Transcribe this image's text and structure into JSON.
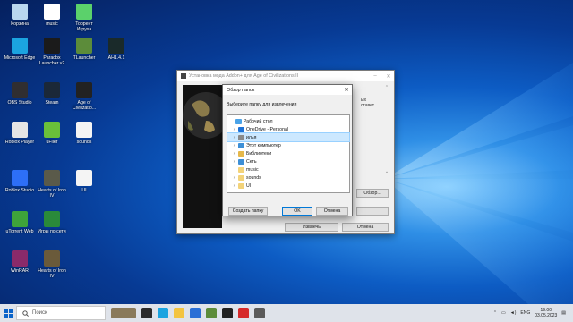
{
  "desktop": {
    "icons": [
      {
        "label": "Корзина",
        "icon": "recycle-bin-icon",
        "color": "#b9d7ef"
      },
      {
        "label": "music",
        "icon": "file-icon",
        "color": "#ffffff"
      },
      {
        "label": "Торрент Игруха",
        "icon": "torrent-app-icon",
        "color": "#5bd16b"
      },
      {
        "label": "Microsoft Edge",
        "icon": "edge-icon",
        "color": "#1ba4e0"
      },
      {
        "label": "Paradox Launcher v2",
        "icon": "paradox-icon",
        "color": "#1b1b1b"
      },
      {
        "label": "TLauncher",
        "icon": "minecraft-icon",
        "color": "#5c8c3a"
      },
      {
        "label": "AH1.4.1",
        "icon": "ah-icon",
        "color": "#1a2a2a"
      },
      {
        "label": "OBS Studio",
        "icon": "obs-icon",
        "color": "#302e31"
      },
      {
        "label": "Steam",
        "icon": "steam-icon",
        "color": "#1b2838"
      },
      {
        "label": "Age of Civilizatio...",
        "icon": "age-of-civilizations-icon",
        "color": "#222222"
      },
      {
        "label": "Roblox Player",
        "icon": "roblox-icon",
        "color": "#e5e5e5"
      },
      {
        "label": "uFiler",
        "icon": "ufiler-icon",
        "color": "#6abf3a"
      },
      {
        "label": "sounds",
        "icon": "file-icon",
        "color": "#f4f4f4"
      },
      {
        "label": "Roblox Studio",
        "icon": "roblox-studio-icon",
        "color": "#2d6ff7"
      },
      {
        "label": "Hearts of Iron IV",
        "icon": "hearts-of-iron-icon",
        "color": "#5a5a4a"
      },
      {
        "label": "UI",
        "icon": "file-icon",
        "color": "#f4f4f4"
      },
      {
        "label": "uTorrent Web",
        "icon": "utorrent-icon",
        "color": "#3ea43a"
      },
      {
        "label": "Игры по сети",
        "icon": "ftp-icon",
        "color": "#2a8a3a"
      },
      {
        "label": "WinRAR",
        "icon": "winrar-icon",
        "color": "#8a2a6a"
      },
      {
        "label": "Hearts of Iron IV",
        "icon": "hearts-of-iron-icon",
        "color": "#6a5a3a"
      }
    ]
  },
  "setup_window": {
    "title": "Установка мода Addon+ для Age of Civilizations II",
    "body_text": [
      "ых",
      "ставет"
    ],
    "browse_label": "Обзор...",
    "extract_label": "Извлечь",
    "cancel_label": "Отмена"
  },
  "folder_dialog": {
    "title": "Обзор папок",
    "instruction": "Выберите папку для извлечения",
    "tree": [
      {
        "label": "Рабочий стол",
        "icon": "desktop-folder-icon",
        "color": "#4aa3e8",
        "level": 0,
        "chevron": "",
        "selected": false
      },
      {
        "label": "OneDrive - Personal",
        "icon": "onedrive-icon",
        "color": "#1e73d8",
        "level": 1,
        "chevron": "›",
        "selected": false
      },
      {
        "label": "илья",
        "icon": "user-icon",
        "color": "#8a8a8a",
        "level": 1,
        "chevron": "›",
        "selected": true
      },
      {
        "label": "Этот компьютер",
        "icon": "computer-icon",
        "color": "#3d8fd6",
        "level": 1,
        "chevron": "›",
        "selected": false
      },
      {
        "label": "Библиотеки",
        "icon": "library-icon",
        "color": "#e6b84a",
        "level": 1,
        "chevron": "›",
        "selected": false
      },
      {
        "label": "Сеть",
        "icon": "network-icon",
        "color": "#3d8fd6",
        "level": 1,
        "chevron": "›",
        "selected": false
      },
      {
        "label": "music",
        "icon": "folder-icon",
        "color": "#f3d37a",
        "level": 1,
        "chevron": "",
        "selected": false
      },
      {
        "label": "sounds",
        "icon": "folder-icon",
        "color": "#f3d37a",
        "level": 1,
        "chevron": "›",
        "selected": false
      },
      {
        "label": "UI",
        "icon": "folder-icon",
        "color": "#f3d37a",
        "level": 1,
        "chevron": "›",
        "selected": false
      }
    ],
    "new_folder_label": "Создать папку",
    "ok_label": "OK",
    "cancel_label": "Отмена"
  },
  "taskbar": {
    "search_placeholder": "Поиск",
    "apps": [
      {
        "icon": "horse-app-icon",
        "color": "#8a7a5a"
      },
      {
        "icon": "task-view-icon",
        "color": "#2b2b2b"
      },
      {
        "icon": "edge-icon",
        "color": "#1ba4e0"
      },
      {
        "icon": "file-explorer-icon",
        "color": "#f3c440"
      },
      {
        "icon": "mail-icon",
        "color": "#2a6fd6"
      },
      {
        "icon": "minecraft-icon",
        "color": "#5c8c3a"
      },
      {
        "icon": "media-icon",
        "color": "#222222"
      },
      {
        "icon": "record-icon",
        "color": "#d62a2a"
      },
      {
        "icon": "setup-app-icon",
        "color": "#5a5a5a"
      }
    ],
    "language": "ENG",
    "time": "19:00",
    "date": "03.05.2023"
  }
}
